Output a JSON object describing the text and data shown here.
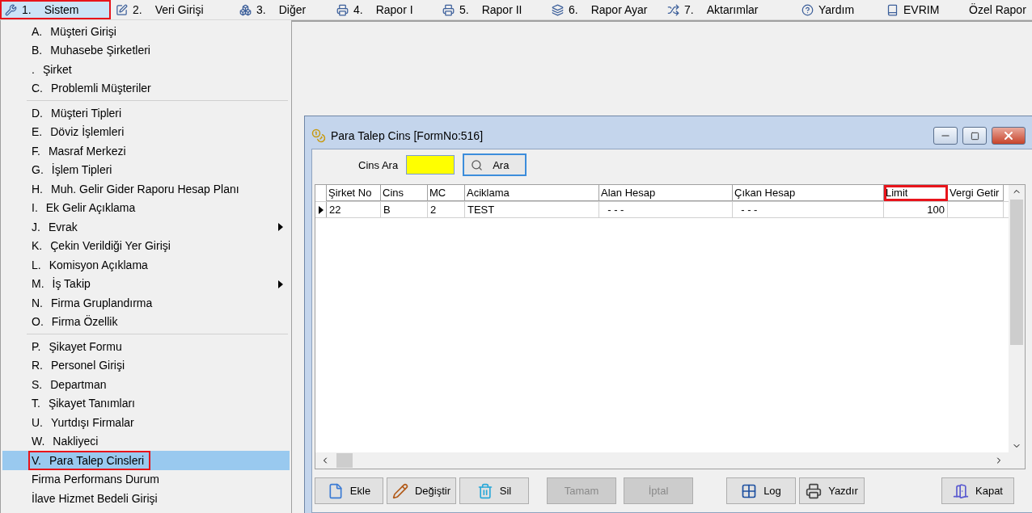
{
  "menubar": [
    {
      "number": "1.",
      "label": "Sistem",
      "selected": true,
      "highlighted": true
    },
    {
      "number": "2.",
      "label": "Veri Girişi",
      "selected": false,
      "highlighted": false
    },
    {
      "number": "3.",
      "label": "Diğer",
      "selected": false,
      "highlighted": false
    },
    {
      "number": "4.",
      "label": "Rapor I",
      "selected": false,
      "highlighted": false
    },
    {
      "number": "5.",
      "label": "Rapor II",
      "selected": false,
      "highlighted": false
    },
    {
      "number": "6.",
      "label": "Rapor Ayar",
      "selected": false,
      "highlighted": false
    },
    {
      "number": "7.",
      "label": "Aktarımlar",
      "selected": false,
      "highlighted": false
    },
    {
      "label": "Yardım",
      "selected": false,
      "highlighted": false
    },
    {
      "label": "EVRIM",
      "selected": false,
      "highlighted": false
    },
    {
      "label": "Özel Rapor",
      "selected": false,
      "highlighted": false
    }
  ],
  "menu_groups": [
    [
      {
        "key": "A.",
        "label": "Müşteri Girişi",
        "selected": false,
        "highlighted": false,
        "submenu": false
      },
      {
        "key": "B.",
        "label": "Muhasebe Şirketleri",
        "selected": false,
        "highlighted": false,
        "submenu": false
      },
      {
        "key": ".",
        "label": "Şirket",
        "selected": false,
        "highlighted": false,
        "submenu": false
      },
      {
        "key": "C.",
        "label": "Problemli Müşteriler",
        "selected": false,
        "highlighted": false,
        "submenu": false
      }
    ],
    [
      {
        "key": "D.",
        "label": "Müşteri Tipleri",
        "selected": false,
        "highlighted": false,
        "submenu": false
      },
      {
        "key": "E.",
        "label": "Döviz İşlemleri",
        "selected": false,
        "highlighted": false,
        "submenu": false
      },
      {
        "key": "F.",
        "label": "Masraf Merkezi",
        "selected": false,
        "highlighted": false,
        "submenu": false
      },
      {
        "key": "G.",
        "label": "İşlem Tipleri",
        "selected": false,
        "highlighted": false,
        "submenu": false
      },
      {
        "key": "H.",
        "label": "Muh. Gelir Gider Raporu Hesap Planı",
        "selected": false,
        "highlighted": false,
        "submenu": false
      },
      {
        "key": "I.",
        "label": "Ek Gelir Açıklama",
        "selected": false,
        "highlighted": false,
        "submenu": false
      },
      {
        "key": "J.",
        "label": "Evrak",
        "selected": false,
        "highlighted": false,
        "submenu": true
      },
      {
        "key": "K.",
        "label": "Çekin Verildiği Yer Girişi",
        "selected": false,
        "highlighted": false,
        "submenu": false
      },
      {
        "key": "L.",
        "label": "Komisyon Açıklama",
        "selected": false,
        "highlighted": false,
        "submenu": false
      },
      {
        "key": "M.",
        "label": "İş Takip",
        "selected": false,
        "highlighted": false,
        "submenu": true
      },
      {
        "key": "N.",
        "label": "Firma Gruplandırma",
        "selected": false,
        "highlighted": false,
        "submenu": false
      },
      {
        "key": "O.",
        "label": "Firma Özellik",
        "selected": false,
        "highlighted": false,
        "submenu": false
      }
    ],
    [
      {
        "key": "P.",
        "label": "Şikayet Formu",
        "selected": false,
        "highlighted": false,
        "submenu": false
      },
      {
        "key": "R.",
        "label": "Personel Girişi",
        "selected": false,
        "highlighted": false,
        "submenu": false
      },
      {
        "key": "S.",
        "label": "Departman",
        "selected": false,
        "highlighted": false,
        "submenu": false
      },
      {
        "key": "T.",
        "label": "Şikayet Tanımları",
        "selected": false,
        "highlighted": false,
        "submenu": false
      },
      {
        "key": "U.",
        "label": "Yurtdışı Firmalar",
        "selected": false,
        "highlighted": false,
        "submenu": false
      },
      {
        "key": "W.",
        "label": "Nakliyeci",
        "selected": false,
        "highlighted": false,
        "submenu": false
      },
      {
        "key": "V.",
        "label": "Para Talep Cinsleri",
        "selected": true,
        "highlighted": true,
        "submenu": false
      },
      {
        "label": "Firma Performans Durum",
        "selected": false,
        "highlighted": false,
        "submenu": false
      },
      {
        "label": "İlave Hizmet Bedeli Girişi",
        "selected": false,
        "highlighted": false,
        "submenu": false
      }
    ]
  ],
  "window": {
    "title": "Para Talep Cins [FormNo:516]",
    "search": {
      "label": "Cins Ara",
      "button": "Ara"
    },
    "table": {
      "columns": [
        {
          "label": "Şirket No",
          "kind": "text",
          "highlighted": false
        },
        {
          "label": "Cins",
          "kind": "text",
          "highlighted": false
        },
        {
          "label": "MC",
          "kind": "text",
          "highlighted": false
        },
        {
          "label": "Aciklama",
          "kind": "text",
          "highlighted": false
        },
        {
          "label": "Alan Hesap",
          "kind": "text",
          "highlighted": false
        },
        {
          "label": "Çıkan Hesap",
          "kind": "text",
          "highlighted": false
        },
        {
          "label": "Limit",
          "kind": "number",
          "highlighted": true
        },
        {
          "label": "Vergi Getir",
          "kind": "text",
          "highlighted": false
        }
      ],
      "rows": [
        {
          "current": true,
          "cells": [
            "22",
            "B",
            "2",
            "TEST",
            "  - - -",
            "  - - -",
            "100"
          ]
        }
      ]
    },
    "buttons": [
      {
        "label": "Ekle",
        "disabled": false
      },
      {
        "label": "Değiştir",
        "disabled": false
      },
      {
        "label": "Sil",
        "disabled": false
      },
      {
        "label": "Tamam",
        "disabled": true
      },
      {
        "label": "İptal",
        "disabled": true
      },
      {
        "label": "Log",
        "disabled": false
      },
      {
        "label": "Yazdır",
        "disabled": false
      },
      {
        "label": "Kapat",
        "disabled": false
      }
    ]
  }
}
